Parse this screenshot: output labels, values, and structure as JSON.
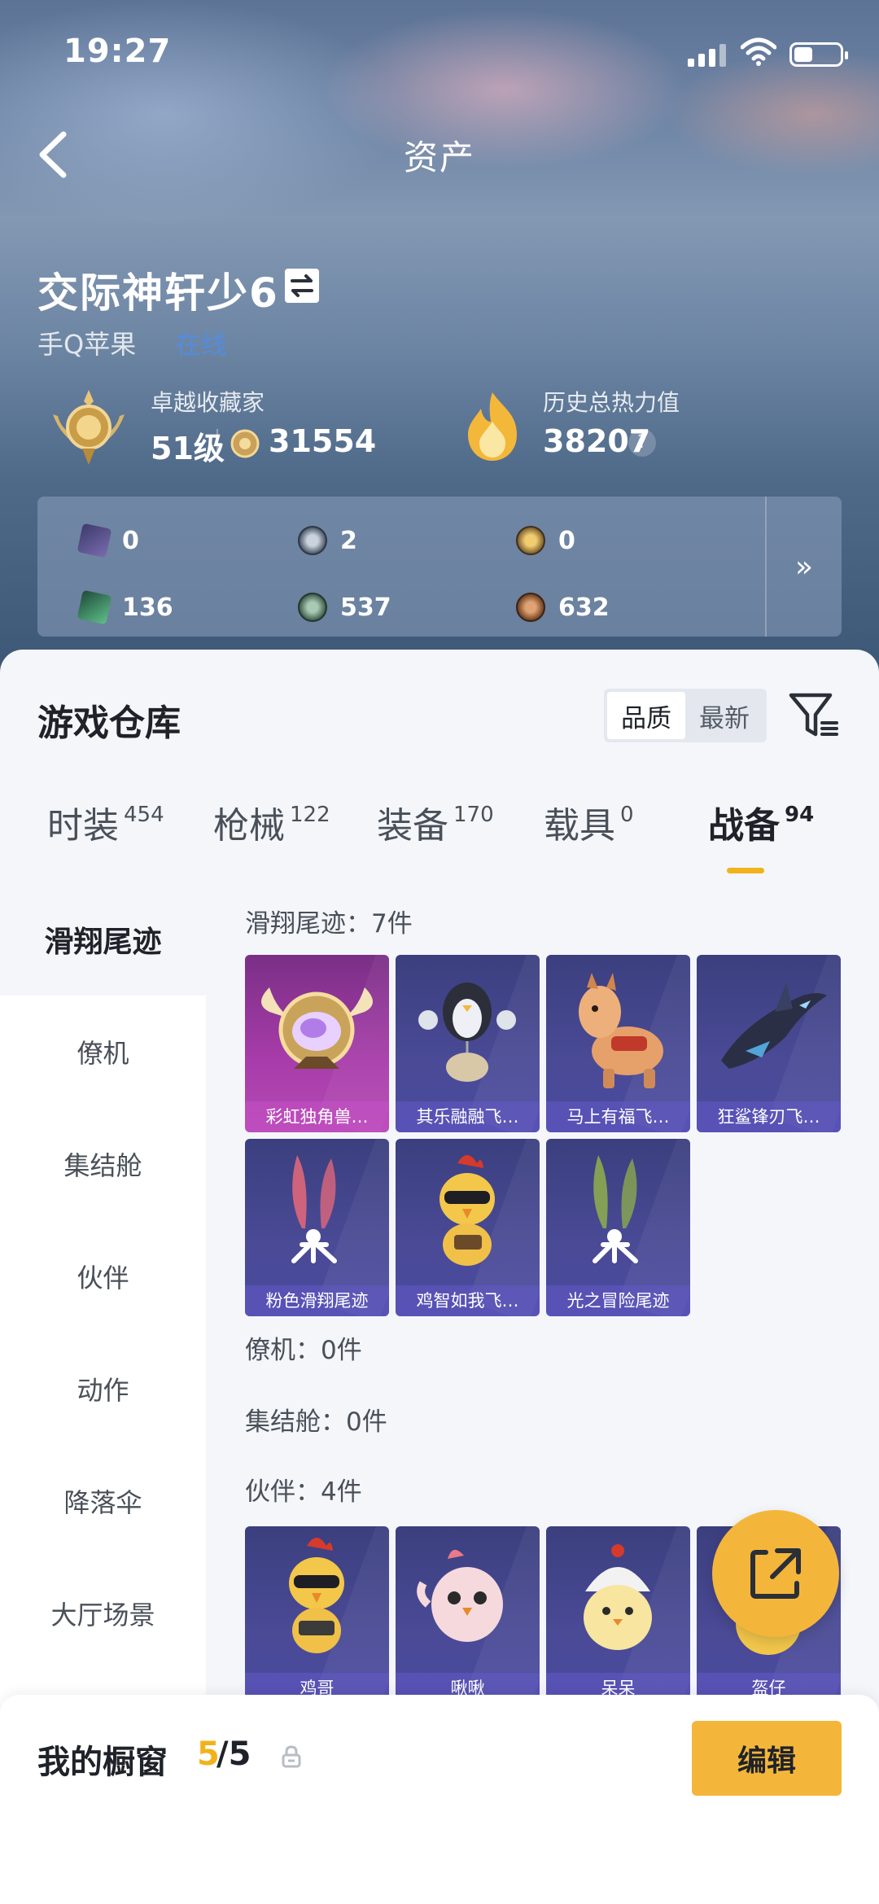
{
  "status_bar": {
    "time": "19:27"
  },
  "header": {
    "title": "资产"
  },
  "player": {
    "name": "交际神轩少6",
    "platform": "手Q苹果",
    "online_status": "在线",
    "collector": {
      "label": "卓越收藏家",
      "level": "51级",
      "points": "31554"
    },
    "heat": {
      "label": "历史总热力值",
      "value": "38207",
      "help": "?"
    }
  },
  "currencies": {
    "items": [
      {
        "icon": "purple-card-icon",
        "value": "0"
      },
      {
        "icon": "silver-coin-icon",
        "value": "2"
      },
      {
        "icon": "gold-star-coin-icon",
        "value": "0"
      },
      {
        "icon": "green-card-icon",
        "value": "136"
      },
      {
        "icon": "green-coin-icon",
        "value": "537"
      },
      {
        "icon": "bronze-coin-icon",
        "value": "632"
      }
    ],
    "more": "»"
  },
  "warehouse": {
    "title": "游戏仓库",
    "sort_options": [
      "品质",
      "最新"
    ],
    "sort_selected": "品质"
  },
  "tabs": [
    {
      "label": "时装",
      "count": "454"
    },
    {
      "label": "枪械",
      "count": "122"
    },
    {
      "label": "装备",
      "count": "170"
    },
    {
      "label": "载具",
      "count": "0"
    },
    {
      "label": "战备",
      "count": "94"
    }
  ],
  "active_tab": "战备",
  "sidebar": {
    "items": [
      "滑翔尾迹",
      "僚机",
      "集结舱",
      "伙伴",
      "动作",
      "降落伞",
      "大厅场景"
    ],
    "active": "滑翔尾迹"
  },
  "sections": {
    "glide": {
      "title": "滑翔尾迹：7件"
    },
    "wingman": {
      "title": "僚机：0件"
    },
    "capsule": {
      "title": "集结舱：0件"
    },
    "partner": {
      "title": "伙伴：4件"
    }
  },
  "glide_items": [
    {
      "name": "彩虹独角兽…",
      "quality": "pink"
    },
    {
      "name": "其乐融融飞…",
      "quality": "purple"
    },
    {
      "name": "马上有福飞…",
      "quality": "purple"
    },
    {
      "name": "狂鲨锋刃飞…",
      "quality": "purple"
    },
    {
      "name": "粉色滑翔尾迹",
      "quality": "purple"
    },
    {
      "name": "鸡智如我飞…",
      "quality": "purple"
    },
    {
      "name": "光之冒险尾迹",
      "quality": "purple"
    }
  ],
  "partner_items": [
    {
      "name": "鸡哥"
    },
    {
      "name": "啾啾"
    },
    {
      "name": "呆呆"
    },
    {
      "name": "盔仔"
    }
  ],
  "showcase": {
    "label": "我的橱窗",
    "count": "5",
    "total": "/5",
    "edit_label": "编辑"
  }
}
